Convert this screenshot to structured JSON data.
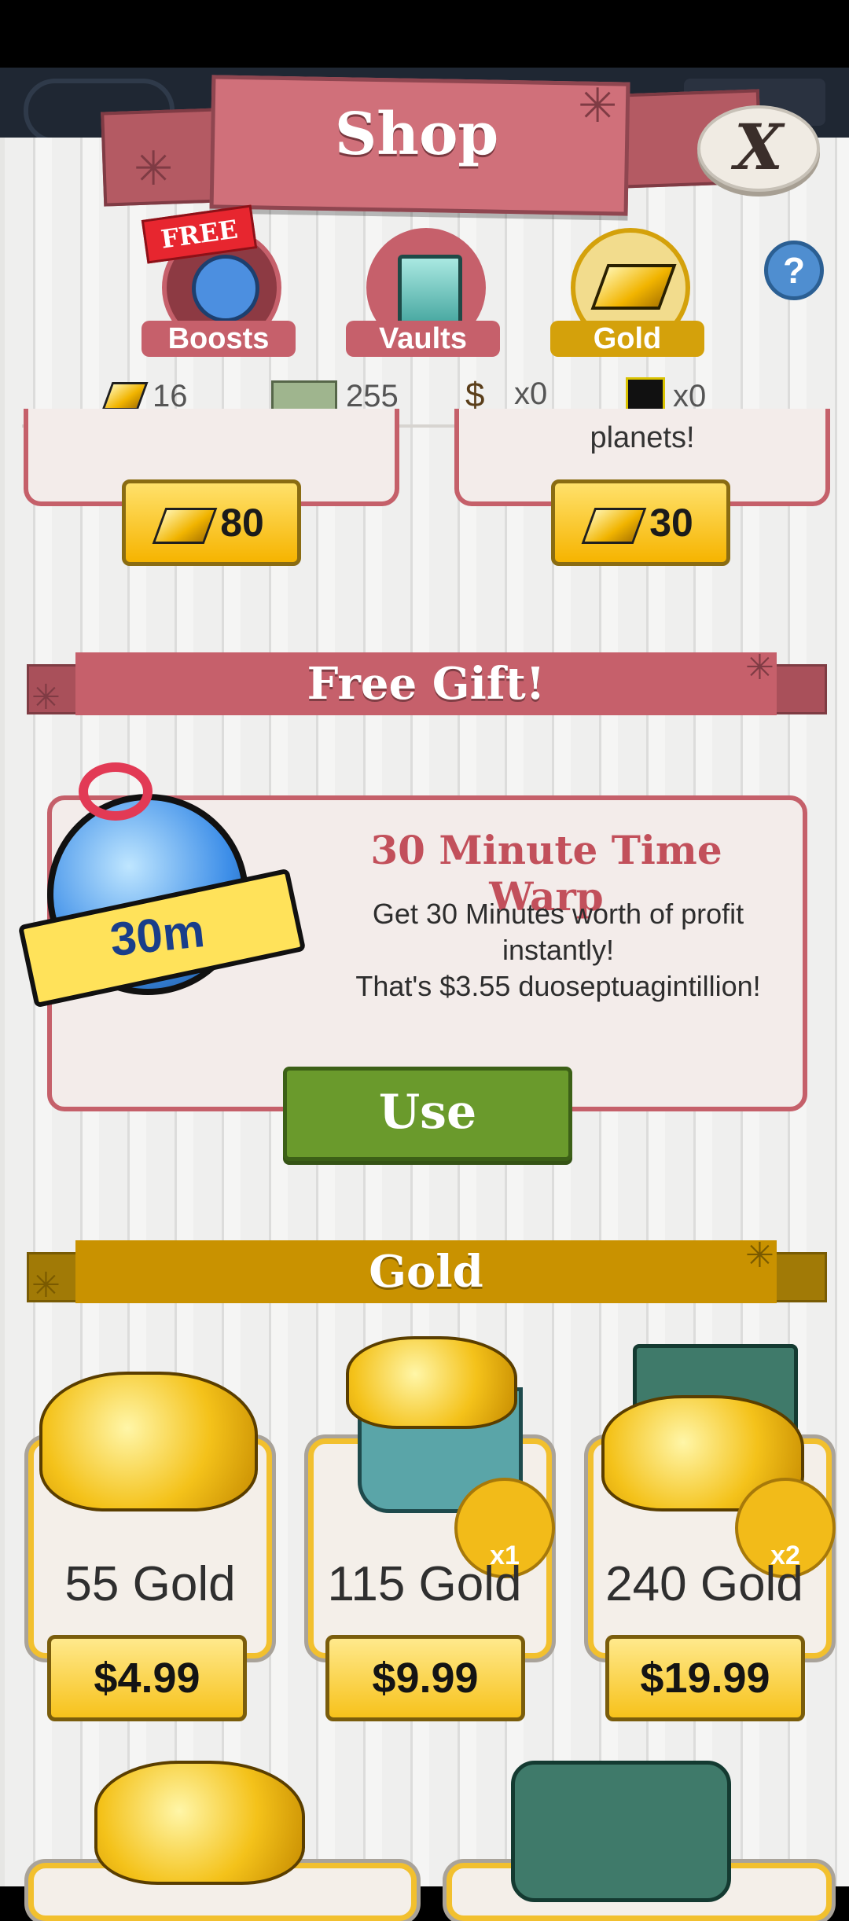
{
  "header": {
    "title": "Shop",
    "close_label": "X"
  },
  "tabs": [
    {
      "label": "Boosts",
      "badge": "FREE",
      "icon": "stopwatch-icon",
      "color": "#c6606b"
    },
    {
      "label": "Vaults",
      "icon": "vault-icon",
      "color": "#c6606b"
    },
    {
      "label": "Gold",
      "icon": "gold-bar-icon",
      "color": "#d4a10b",
      "selected": true
    }
  ],
  "help_label": "?",
  "currencies": [
    {
      "icon": "gold-icon",
      "value": "16"
    },
    {
      "icon": "megabuck-icon",
      "value": "255"
    },
    {
      "icon": "money-bag-icon",
      "value": "x0"
    },
    {
      "icon": "chip-icon",
      "value": "x0"
    }
  ],
  "top_cards": [
    {
      "text": "",
      "price": "80"
    },
    {
      "text": "planets!",
      "price": "30"
    }
  ],
  "free_gift": {
    "section_title": "Free Gift!",
    "icon_label": "30m",
    "title": "30 Minute Time Warp",
    "description": [
      "Get 30 Minutes worth of profit",
      "instantly!",
      "That's $3.55 duoseptuagintillion!"
    ],
    "button": "Use"
  },
  "gold_section": {
    "title": "Gold",
    "offers": [
      {
        "amount": "55 Gold",
        "price": "$4.99",
        "badge": ""
      },
      {
        "amount": "115 Gold",
        "price": "$9.99",
        "badge": "x1"
      },
      {
        "amount": "240 Gold",
        "price": "$19.99",
        "badge": "x2"
      }
    ]
  },
  "colors": {
    "accent_red": "#c6606b",
    "gold": "#d4a10b",
    "use_green": "#6a9a2c"
  }
}
